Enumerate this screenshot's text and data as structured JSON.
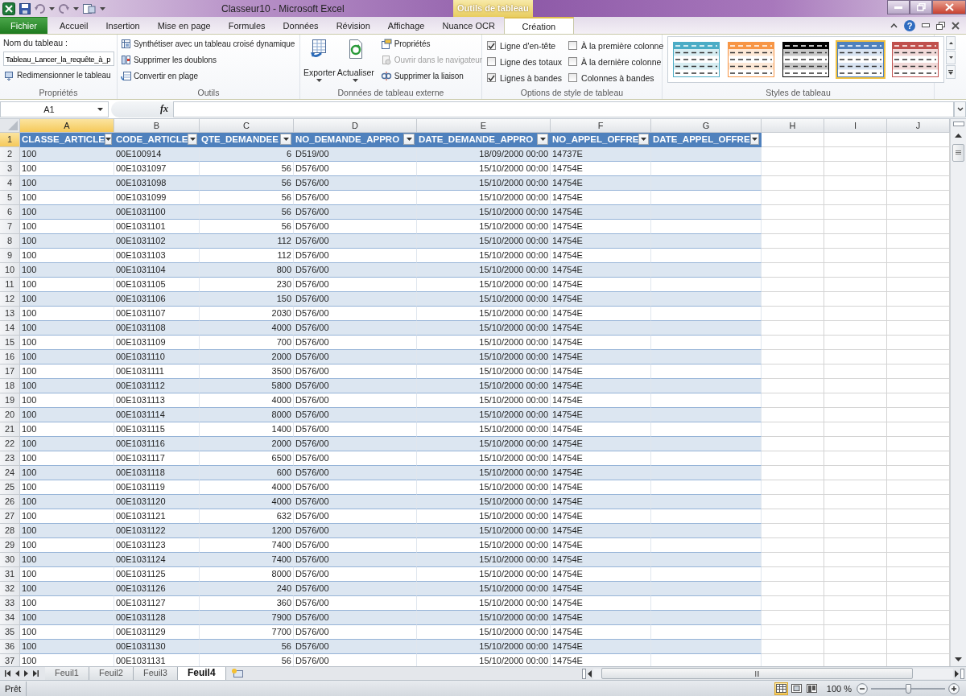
{
  "window": {
    "title": "Classeur10 - Microsoft Excel",
    "context_tab_group": "Outils de tableau"
  },
  "tabs": [
    {
      "label": "Fichier",
      "kind": "file",
      "selected": false
    },
    {
      "label": "Accueil",
      "kind": "normal",
      "selected": false
    },
    {
      "label": "Insertion",
      "kind": "normal",
      "selected": false
    },
    {
      "label": "Mise en page",
      "kind": "normal",
      "selected": false
    },
    {
      "label": "Formules",
      "kind": "normal",
      "selected": false
    },
    {
      "label": "Données",
      "kind": "normal",
      "selected": false
    },
    {
      "label": "Révision",
      "kind": "normal",
      "selected": false
    },
    {
      "label": "Affichage",
      "kind": "normal",
      "selected": false
    },
    {
      "label": "Nuance OCR",
      "kind": "normal",
      "selected": false
    },
    {
      "label": "Création",
      "kind": "context",
      "selected": true
    }
  ],
  "help": "?",
  "ribbon": {
    "properties": {
      "title": "Propriétés",
      "name_label": "Nom du tableau :",
      "name_value": "Tableau_Lancer_la_requête_à_p",
      "resize": "Redimensionner le tableau"
    },
    "tools": {
      "title": "Outils",
      "items": [
        "Synthétiser avec un tableau croisé dynamique",
        "Supprimer les doublons",
        "Convertir en plage"
      ]
    },
    "external": {
      "title": "Données de tableau externe",
      "big": [
        "Exporter",
        "Actualiser"
      ],
      "items": [
        {
          "label": "Propriétés",
          "disabled": false
        },
        {
          "label": "Ouvrir dans le navigateur",
          "disabled": true
        },
        {
          "label": "Supprimer la liaison",
          "disabled": false
        }
      ]
    },
    "style_options": {
      "title": "Options de style de tableau",
      "options": [
        {
          "label": "Ligne d'en-tête",
          "checked": true
        },
        {
          "label": "Ligne des totaux",
          "checked": false
        },
        {
          "label": "Lignes à bandes",
          "checked": true
        },
        {
          "label": "À la première colonne",
          "checked": false
        },
        {
          "label": "À la dernière colonne",
          "checked": false
        },
        {
          "label": "Colonnes à bandes",
          "checked": false
        }
      ]
    },
    "styles": {
      "title": "Styles de tableau",
      "items": [
        {
          "color": "#4bacc6",
          "selected": false
        },
        {
          "color": "#f79646",
          "selected": false
        },
        {
          "color": "#000000",
          "selected": false
        },
        {
          "color": "#4f81bd",
          "selected": true
        },
        {
          "color": "#c0504d",
          "selected": false
        }
      ]
    }
  },
  "formula_bar": {
    "name_box": "A1",
    "fx": "fx"
  },
  "sheet": {
    "columns": [
      {
        "label": "A",
        "selected": true
      },
      {
        "label": "B",
        "selected": false
      },
      {
        "label": "C",
        "selected": false
      },
      {
        "label": "D",
        "selected": false
      },
      {
        "label": "E",
        "selected": false
      },
      {
        "label": "F",
        "selected": false
      },
      {
        "label": "G",
        "selected": false
      },
      {
        "label": "H",
        "selected": false
      },
      {
        "label": "I",
        "selected": false
      },
      {
        "label": "J",
        "selected": false
      }
    ],
    "header_row": {
      "n": "1",
      "selected": true
    },
    "table_headers": [
      "CLASSE_ARTICLE",
      "CODE_ARTICLE",
      "QTE_DEMANDEE",
      "NO_DEMANDE_APPRO",
      "DATE_DEMANDE_APPRO",
      "NO_APPEL_OFFRE",
      "DATE_APPEL_OFFRE"
    ],
    "rows": [
      {
        "n": "2",
        "cells": [
          "100",
          "00E100914",
          "6",
          "D519/00",
          "18/09/2000 00:00",
          "14737E"
        ]
      },
      {
        "n": "3",
        "cells": [
          "100",
          "00E1031097",
          "56",
          "D576/00",
          "15/10/2000 00:00",
          "14754E"
        ]
      },
      {
        "n": "4",
        "cells": [
          "100",
          "00E1031098",
          "56",
          "D576/00",
          "15/10/2000 00:00",
          "14754E"
        ]
      },
      {
        "n": "5",
        "cells": [
          "100",
          "00E1031099",
          "56",
          "D576/00",
          "15/10/2000 00:00",
          "14754E"
        ]
      },
      {
        "n": "6",
        "cells": [
          "100",
          "00E1031100",
          "56",
          "D576/00",
          "15/10/2000 00:00",
          "14754E"
        ]
      },
      {
        "n": "7",
        "cells": [
          "100",
          "00E1031101",
          "56",
          "D576/00",
          "15/10/2000 00:00",
          "14754E"
        ]
      },
      {
        "n": "8",
        "cells": [
          "100",
          "00E1031102",
          "112",
          "D576/00",
          "15/10/2000 00:00",
          "14754E"
        ]
      },
      {
        "n": "9",
        "cells": [
          "100",
          "00E1031103",
          "112",
          "D576/00",
          "15/10/2000 00:00",
          "14754E"
        ]
      },
      {
        "n": "10",
        "cells": [
          "100",
          "00E1031104",
          "800",
          "D576/00",
          "15/10/2000 00:00",
          "14754E"
        ]
      },
      {
        "n": "11",
        "cells": [
          "100",
          "00E1031105",
          "230",
          "D576/00",
          "15/10/2000 00:00",
          "14754E"
        ]
      },
      {
        "n": "12",
        "cells": [
          "100",
          "00E1031106",
          "150",
          "D576/00",
          "15/10/2000 00:00",
          "14754E"
        ]
      },
      {
        "n": "13",
        "cells": [
          "100",
          "00E1031107",
          "2030",
          "D576/00",
          "15/10/2000 00:00",
          "14754E"
        ]
      },
      {
        "n": "14",
        "cells": [
          "100",
          "00E1031108",
          "4000",
          "D576/00",
          "15/10/2000 00:00",
          "14754E"
        ]
      },
      {
        "n": "15",
        "cells": [
          "100",
          "00E1031109",
          "700",
          "D576/00",
          "15/10/2000 00:00",
          "14754E"
        ]
      },
      {
        "n": "16",
        "cells": [
          "100",
          "00E1031110",
          "2000",
          "D576/00",
          "15/10/2000 00:00",
          "14754E"
        ]
      },
      {
        "n": "17",
        "cells": [
          "100",
          "00E1031111",
          "3500",
          "D576/00",
          "15/10/2000 00:00",
          "14754E"
        ]
      },
      {
        "n": "18",
        "cells": [
          "100",
          "00E1031112",
          "5800",
          "D576/00",
          "15/10/2000 00:00",
          "14754E"
        ]
      },
      {
        "n": "19",
        "cells": [
          "100",
          "00E1031113",
          "4000",
          "D576/00",
          "15/10/2000 00:00",
          "14754E"
        ]
      },
      {
        "n": "20",
        "cells": [
          "100",
          "00E1031114",
          "8000",
          "D576/00",
          "15/10/2000 00:00",
          "14754E"
        ]
      },
      {
        "n": "21",
        "cells": [
          "100",
          "00E1031115",
          "1400",
          "D576/00",
          "15/10/2000 00:00",
          "14754E"
        ]
      },
      {
        "n": "22",
        "cells": [
          "100",
          "00E1031116",
          "2000",
          "D576/00",
          "15/10/2000 00:00",
          "14754E"
        ]
      },
      {
        "n": "23",
        "cells": [
          "100",
          "00E1031117",
          "6500",
          "D576/00",
          "15/10/2000 00:00",
          "14754E"
        ]
      },
      {
        "n": "24",
        "cells": [
          "100",
          "00E1031118",
          "600",
          "D576/00",
          "15/10/2000 00:00",
          "14754E"
        ]
      },
      {
        "n": "25",
        "cells": [
          "100",
          "00E1031119",
          "4000",
          "D576/00",
          "15/10/2000 00:00",
          "14754E"
        ]
      },
      {
        "n": "26",
        "cells": [
          "100",
          "00E1031120",
          "4000",
          "D576/00",
          "15/10/2000 00:00",
          "14754E"
        ]
      },
      {
        "n": "27",
        "cells": [
          "100",
          "00E1031121",
          "632",
          "D576/00",
          "15/10/2000 00:00",
          "14754E"
        ]
      },
      {
        "n": "28",
        "cells": [
          "100",
          "00E1031122",
          "1200",
          "D576/00",
          "15/10/2000 00:00",
          "14754E"
        ]
      },
      {
        "n": "29",
        "cells": [
          "100",
          "00E1031123",
          "7400",
          "D576/00",
          "15/10/2000 00:00",
          "14754E"
        ]
      },
      {
        "n": "30",
        "cells": [
          "100",
          "00E1031124",
          "7400",
          "D576/00",
          "15/10/2000 00:00",
          "14754E"
        ]
      },
      {
        "n": "31",
        "cells": [
          "100",
          "00E1031125",
          "8000",
          "D576/00",
          "15/10/2000 00:00",
          "14754E"
        ]
      },
      {
        "n": "32",
        "cells": [
          "100",
          "00E1031126",
          "240",
          "D576/00",
          "15/10/2000 00:00",
          "14754E"
        ]
      },
      {
        "n": "33",
        "cells": [
          "100",
          "00E1031127",
          "360",
          "D576/00",
          "15/10/2000 00:00",
          "14754E"
        ]
      },
      {
        "n": "34",
        "cells": [
          "100",
          "00E1031128",
          "7900",
          "D576/00",
          "15/10/2000 00:00",
          "14754E"
        ]
      },
      {
        "n": "35",
        "cells": [
          "100",
          "00E1031129",
          "7700",
          "D576/00",
          "15/10/2000 00:00",
          "14754E"
        ]
      },
      {
        "n": "36",
        "cells": [
          "100",
          "00E1031130",
          "56",
          "D576/00",
          "15/10/2000 00:00",
          "14754E"
        ]
      },
      {
        "n": "37",
        "cells": [
          "100",
          "00E1031131",
          "56",
          "D576/00",
          "15/10/2000 00:00",
          "14754E"
        ]
      }
    ]
  },
  "sheet_tabs": [
    {
      "label": "Feuil1",
      "selected": false
    },
    {
      "label": "Feuil2",
      "selected": false
    },
    {
      "label": "Feuil3",
      "selected": false
    },
    {
      "label": "Feuil4",
      "selected": true
    }
  ],
  "status_bar": {
    "text": "Prêt",
    "view_modes": [
      {
        "kind": "normal",
        "selected": true
      },
      {
        "kind": "page-layout",
        "selected": false
      },
      {
        "kind": "page-break",
        "selected": false
      }
    ],
    "zoom": "100 %",
    "zoom_slider": {
      "level": 0.5
    }
  }
}
